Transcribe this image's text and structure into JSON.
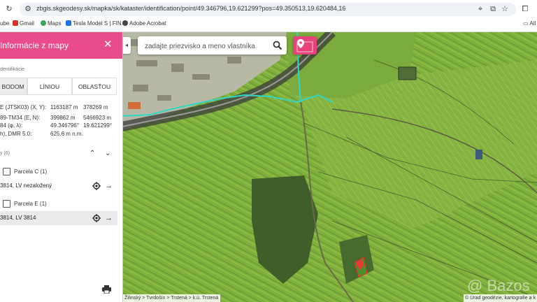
{
  "browser": {
    "url": "zbgis.skgeodesy.sk/mapka/sk/kataster/identification/point/49.346796,19.621299?pos=49.350513,19.620484,16",
    "bookmarks": [
      {
        "label": "ube",
        "color": "#e53935"
      },
      {
        "label": "Gmail",
        "color": "#d93025"
      },
      {
        "label": "Maps",
        "color": "#34a853"
      },
      {
        "label": "Tesla Model S | FIN...",
        "color": "#1a73e8"
      },
      {
        "label": "Adobe Acrobat",
        "color": "#444444"
      }
    ],
    "bookmarks_folder": "All"
  },
  "panel": {
    "title": "Informácie z mapy",
    "identification_label": "dentifikácie",
    "tabs": [
      {
        "label": "BODOM",
        "active": true
      },
      {
        "label": "LÍNIOU",
        "active": false
      },
      {
        "label": "OBLASŤOU",
        "active": false
      }
    ],
    "coordinates": [
      {
        "label": "E (JTSK03) (X, Y):",
        "v1": "1163187 m",
        "v2": "378269 m"
      },
      {
        "label": "89-TM34 (E, N):",
        "v1": "399862 m",
        "v2": "5466923 m"
      },
      {
        "label": "84 (φ, λ):",
        "v1": "49.346796°",
        "v2": "19.621299°"
      },
      {
        "label": "h), DMR 5.0:",
        "v1": "625.6 m n.m.",
        "v2": ""
      }
    ],
    "layers_label": "y (6)",
    "parcels": [
      {
        "group": "Parcela C (1)",
        "item": "3814, LV nezaložený",
        "highlighted": false
      },
      {
        "group": "Parcela E (1)",
        "item": "3814, LV 3814",
        "highlighted": true
      }
    ]
  },
  "map": {
    "search_placeholder": "zadajte priezvisko a meno vlastníka",
    "breadcrumb": "Žilinský > Tvrdošín > Trstená > k.ú. Trstená",
    "attribution": "© Úrad geodézie, kartografie a k",
    "watermark": "@ Bazos",
    "accent_color": "#ea4c89"
  }
}
